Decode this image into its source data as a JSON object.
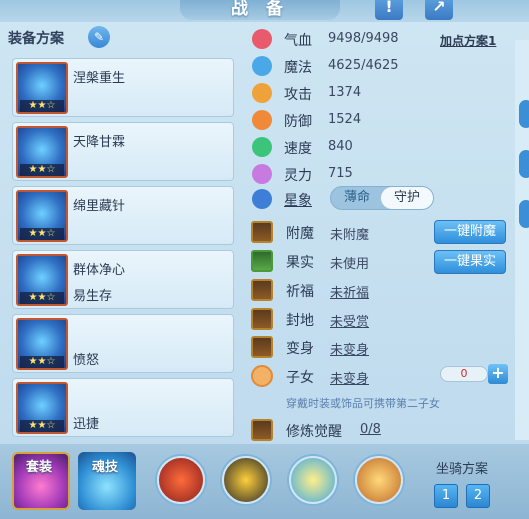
{
  "window": {
    "title": "战 备"
  },
  "equip_plans": {
    "header": "装备方案",
    "cards": [
      {
        "name": "涅槃重生",
        "name2": "",
        "stars": "★★☆"
      },
      {
        "name": "天降甘霖",
        "name2": "",
        "stars": "★★☆"
      },
      {
        "name": "绵里藏针",
        "name2": "",
        "stars": "★★☆"
      },
      {
        "name": "群体净心",
        "name2": "易生存",
        "stars": "★★☆"
      },
      {
        "name": "",
        "name2": "愤怒",
        "stars": "★★☆"
      },
      {
        "name": "",
        "name2": "迅捷",
        "stars": "★★☆"
      }
    ]
  },
  "stats": {
    "plus_plan": "加点方案1",
    "items": [
      {
        "label": "气血",
        "value": "9498/9498",
        "icon": "heart-icon",
        "color": "#e85a6c"
      },
      {
        "label": "魔法",
        "value": "4625/4625",
        "icon": "diamond-icon",
        "color": "#4aa8e8"
      },
      {
        "label": "攻击",
        "value": "1374",
        "icon": "sword-icon",
        "color": "#f0a23a"
      },
      {
        "label": "防御",
        "value": "1524",
        "icon": "shield-icon",
        "color": "#f08a3a"
      },
      {
        "label": "速度",
        "value": "840",
        "icon": "lightning-icon",
        "color": "#3cc47a"
      },
      {
        "label": "灵力",
        "value": "715",
        "icon": "spirit-icon",
        "color": "#c77ae0"
      }
    ],
    "constellation": {
      "label": "星象",
      "option_a": "薄命",
      "option_b": "守护"
    }
  },
  "attributes": [
    {
      "label": "附魔",
      "value": "未附魔",
      "underline": false
    },
    {
      "label": "果实",
      "value": "未使用",
      "underline": false
    },
    {
      "label": "祈福",
      "value": "未祈福",
      "underline": true
    },
    {
      "label": "封地",
      "value": "未受赏",
      "underline": true
    },
    {
      "label": "变身",
      "value": "未变身",
      "underline": true
    },
    {
      "label": "子女",
      "value": "未变身",
      "underline": true
    }
  ],
  "buttons": {
    "enchant_all": "一键附魔",
    "fruit_all": "一键果实"
  },
  "child_counter": "0",
  "hint": "穿戴时装或饰品可携带第二子女",
  "cultivation": {
    "label": "修炼觉醒",
    "value": "0/8"
  },
  "bottom": {
    "suit_label": "套装",
    "soul_label": "魂技",
    "mount_label": "坐骑方案",
    "mount_1": "1",
    "mount_2": "2"
  }
}
